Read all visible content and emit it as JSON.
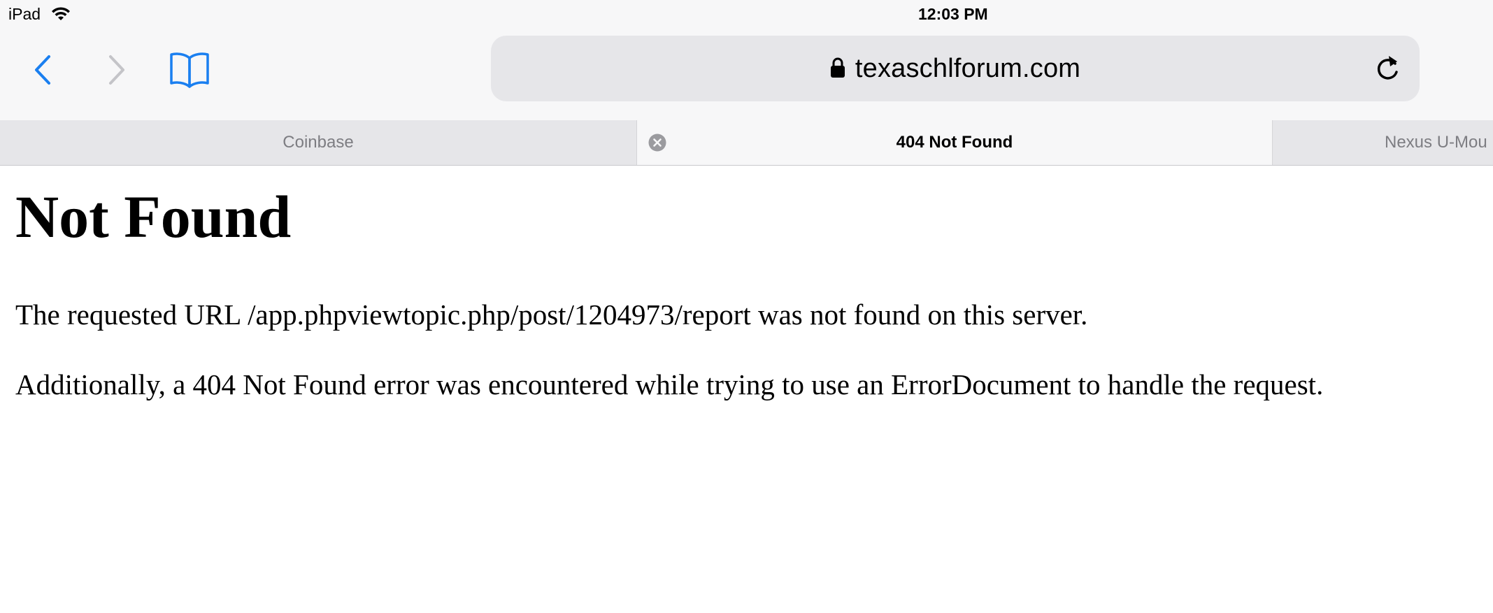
{
  "status_bar": {
    "device": "iPad",
    "time": "12:03 PM",
    "wifi_icon": "wifi-icon"
  },
  "toolbar": {
    "back_icon": "chevron-left-icon",
    "forward_icon": "chevron-right-icon",
    "bookmarks_icon": "book-icon",
    "address": "texaschlforum.com",
    "lock_icon": "lock-icon",
    "reload_icon": "reload-icon"
  },
  "tabs": [
    {
      "label": "Coinbase",
      "active": false
    },
    {
      "label": "404 Not Found",
      "active": true
    },
    {
      "label": "Nexus U-Mou",
      "active": false
    }
  ],
  "page": {
    "heading": "Not Found",
    "paragraphs": [
      "The requested URL /app.phpviewtopic.php/post/1204973/report was not found on this server.",
      "Additionally, a 404 Not Found error was encountered while trying to use an ErrorDocument to handle the request."
    ]
  },
  "colors": {
    "accent": "#1a7ff0",
    "disabled": "#c4c4c8",
    "chrome_bg": "#f7f7f8",
    "field_bg": "#e6e6e9"
  }
}
